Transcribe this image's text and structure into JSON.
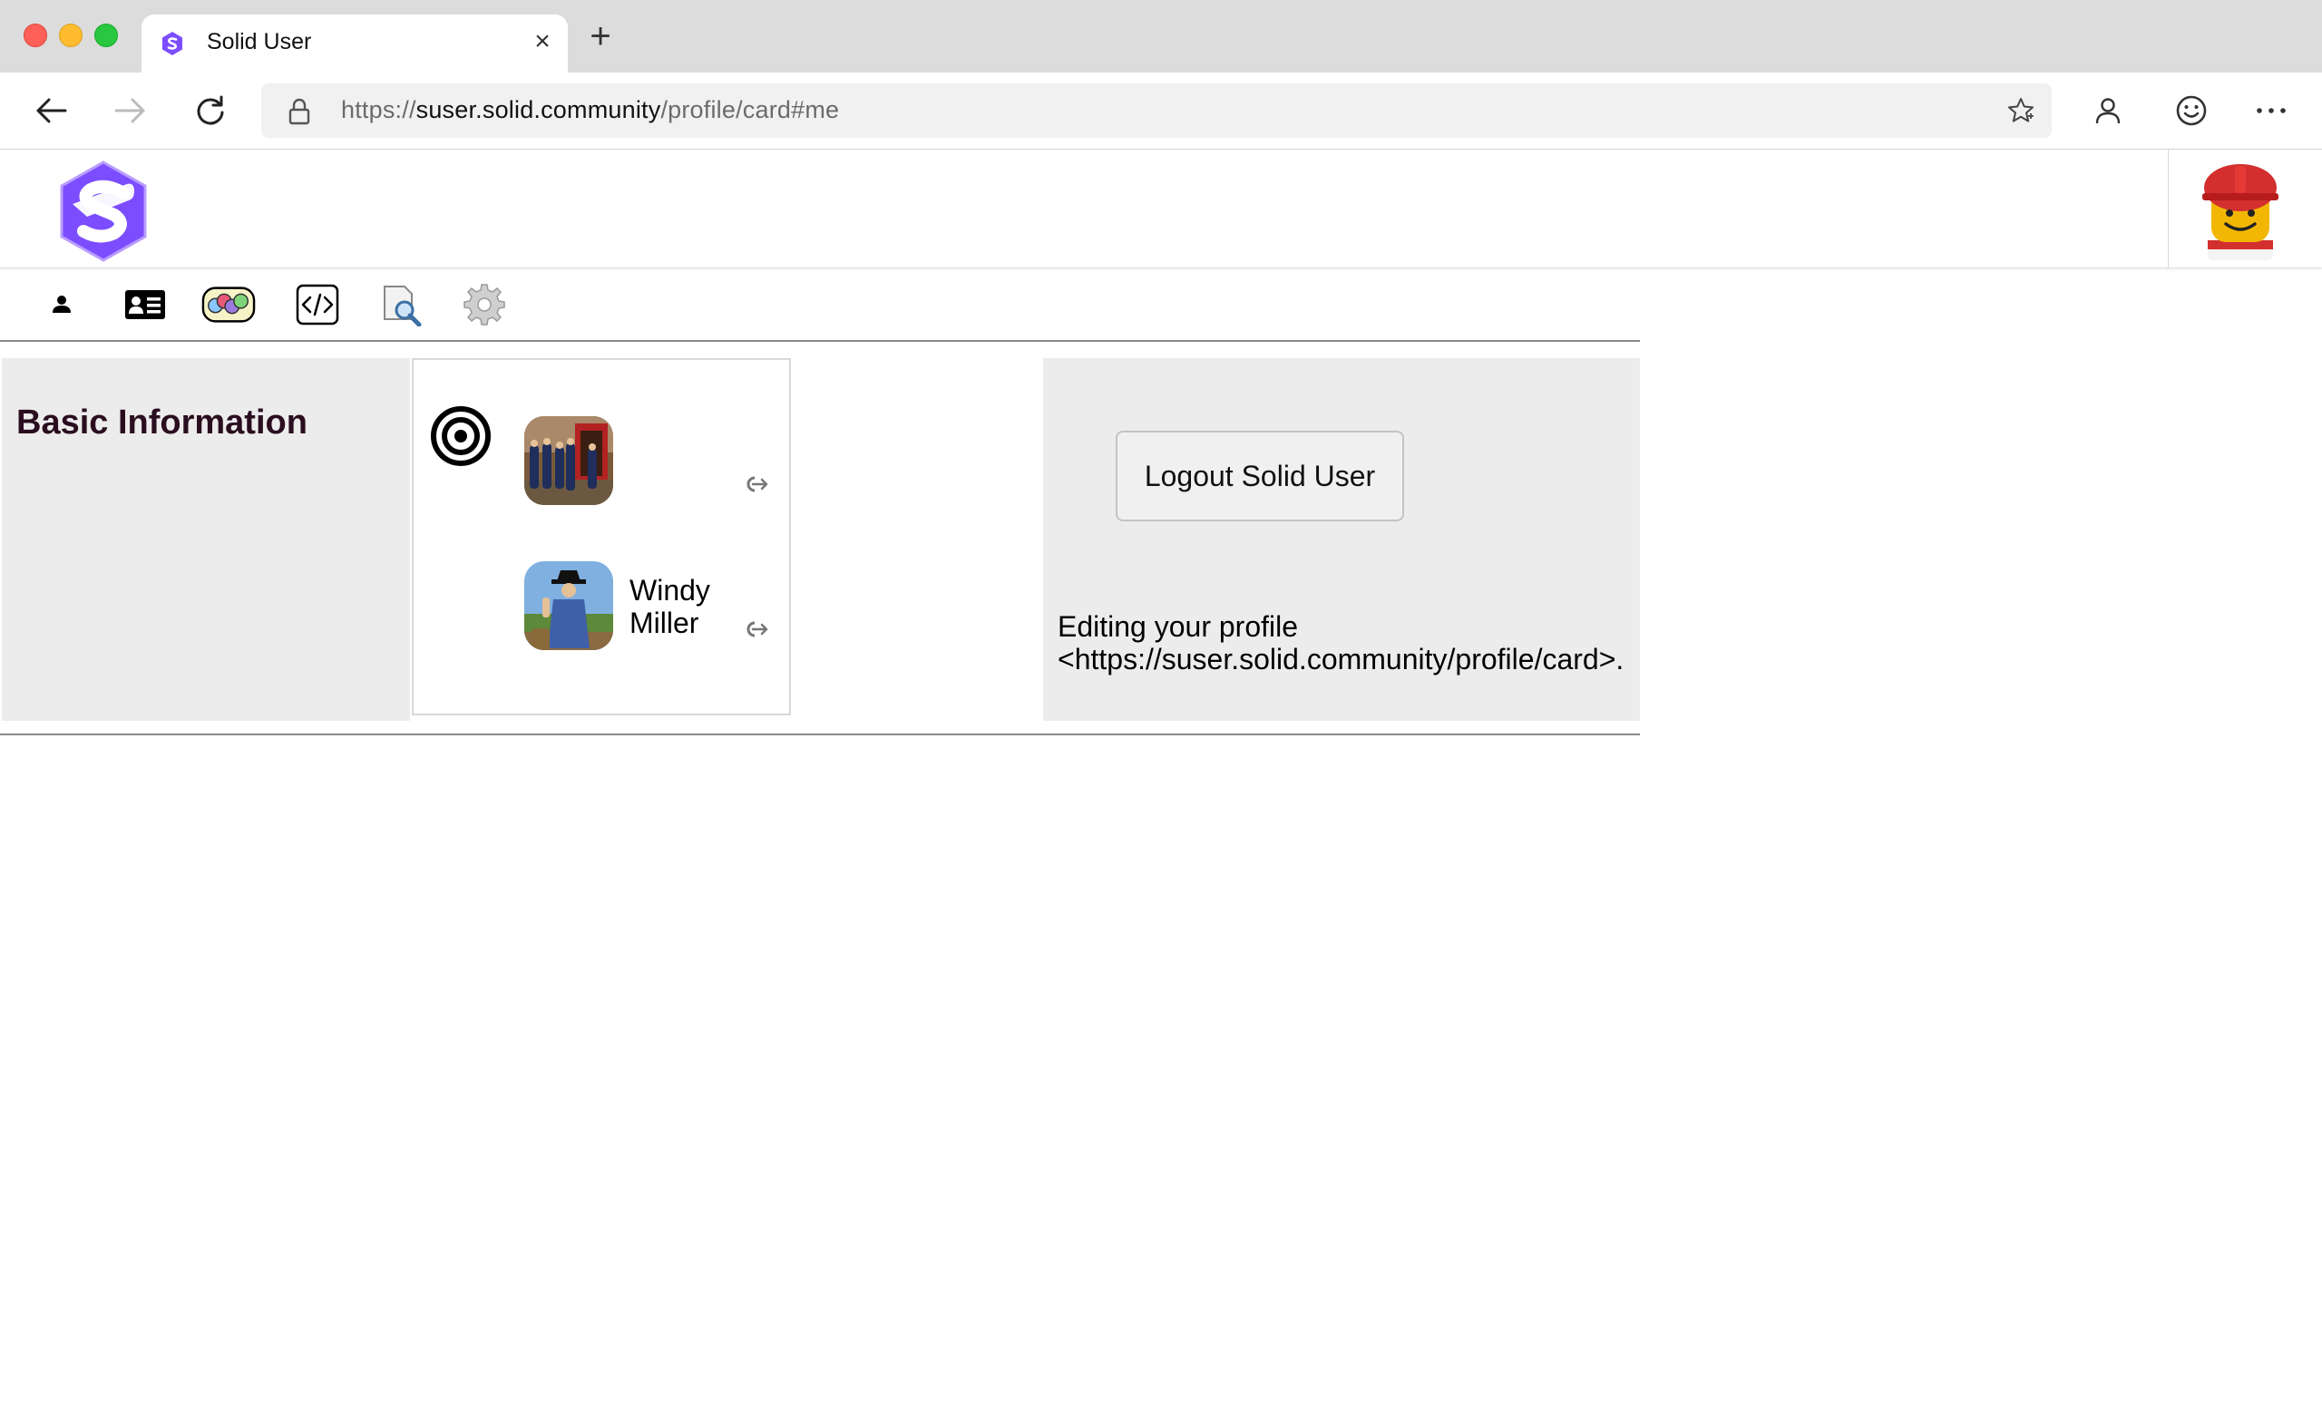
{
  "browser": {
    "tab_title": "Solid User",
    "address": {
      "scheme": "https://",
      "host": "suser.solid.community",
      "path": "/profile/card#me"
    }
  },
  "app": {
    "tabs": [
      "profile-tab",
      "contact-card-tab",
      "friends-tab",
      "source-tab",
      "inspect-tab",
      "settings-tab"
    ]
  },
  "basic_info": {
    "heading": "Basic Information"
  },
  "identities": [
    {
      "name": ""
    },
    {
      "name": "Windy Miller"
    }
  ],
  "logout": {
    "button_label": "Logout Solid User",
    "editing_note_line1": "Editing your profile",
    "editing_note_line2": "<https://suser.solid.community/profile/card>."
  },
  "colors": {
    "solid_purple": "#7c4dff",
    "panel_grey": "#ececec",
    "heading_color": "#2a0e1f"
  }
}
